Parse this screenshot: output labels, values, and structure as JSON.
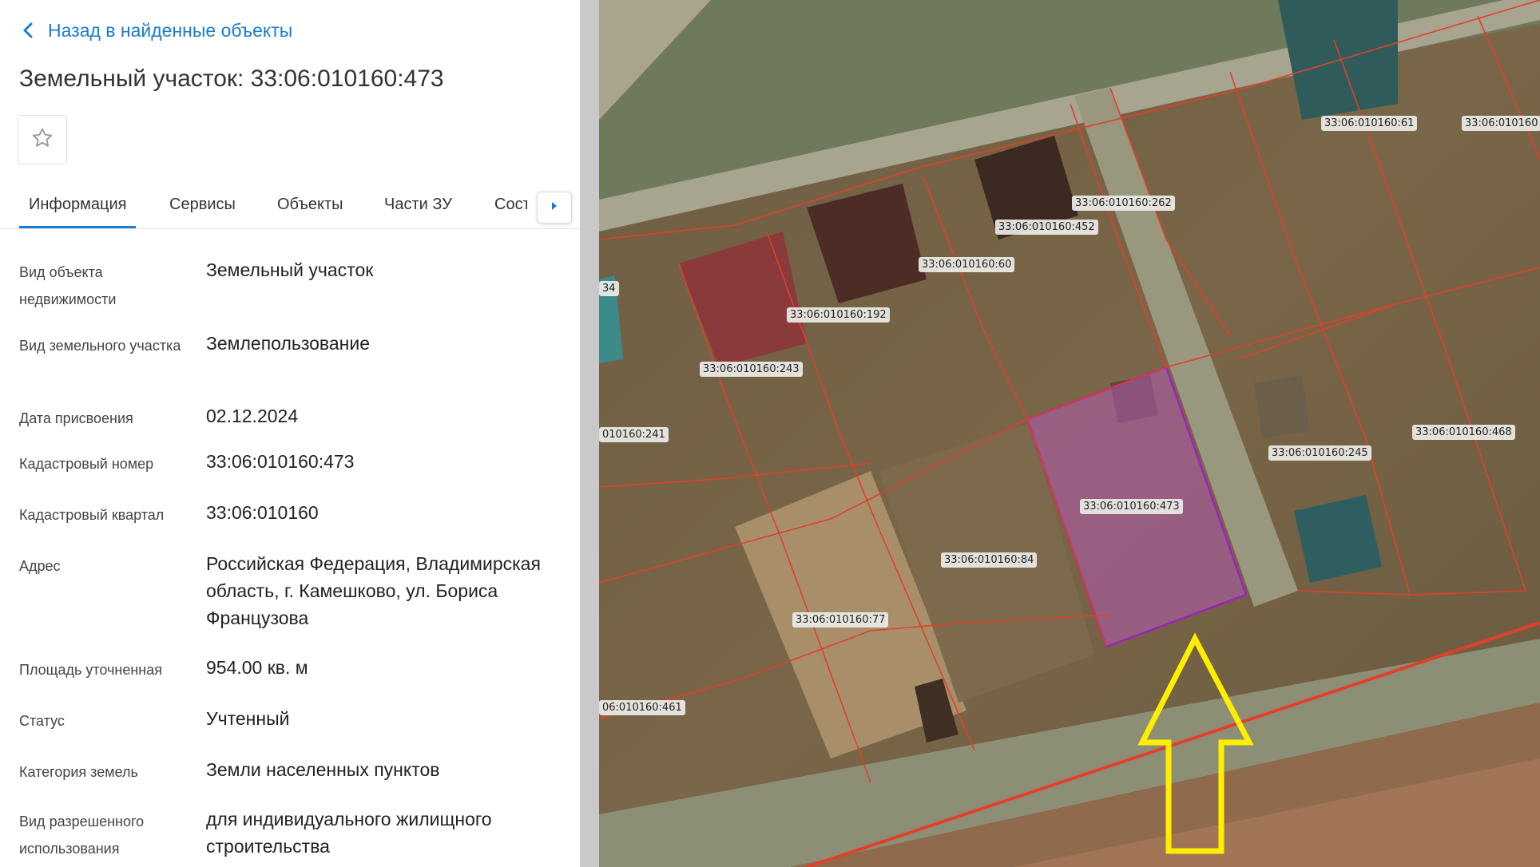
{
  "nav": {
    "back_label": "Назад в найденные объекты"
  },
  "title": "Земельный участок: 33:06:010160:473",
  "tabs": [
    {
      "label": "Информация",
      "active": true
    },
    {
      "label": "Сервисы"
    },
    {
      "label": "Объекты"
    },
    {
      "label": "Части ЗУ"
    },
    {
      "label": "Состав"
    }
  ],
  "properties": [
    {
      "label": "Вид объекта недвижимости",
      "value": "Земельный участок"
    },
    {
      "label": "Вид земельного участка",
      "value": "Землепользование"
    },
    {
      "label": "Дата присвоения",
      "value": "02.12.2024"
    },
    {
      "label": "Кадастровый номер",
      "value": "33:06:010160:473"
    },
    {
      "label": "Кадастровый квартал",
      "value": "33:06:010160"
    },
    {
      "label": "Адрес",
      "value": "Российская Федерация, Владимирская область, г. Камешково, ул. Бориса Французова"
    },
    {
      "label": "Площадь уточненная",
      "value": "954.00 кв. м"
    },
    {
      "label": "Статус",
      "value": "Учтенный"
    },
    {
      "label": "Категория земель",
      "value": "Земли населенных пунктов"
    },
    {
      "label": "Вид разрешенного использования",
      "value": "для индивидуального жилищного строительства"
    }
  ],
  "map": {
    "plot_labels": [
      "33:06:010160:61",
      "33:06:010160",
      "33:06:010160:262",
      "33:06:010160:452",
      "33:06:010160:60",
      "33:06:010160:192",
      "33:06:010160:243",
      "010160:241",
      "33:06:010160:473",
      "33:06:010160:245",
      "33:06:010160:468",
      "33:06:010160:84",
      "33:06:010160:77",
      "06:010160:461",
      "34"
    ],
    "selected_plot": "33:06:010160:473",
    "colors": {
      "boundary": "#e0402a",
      "selected_fill": "#b25bb2",
      "selected_stroke": "#a020c0",
      "arrow": "#ffee00"
    }
  }
}
